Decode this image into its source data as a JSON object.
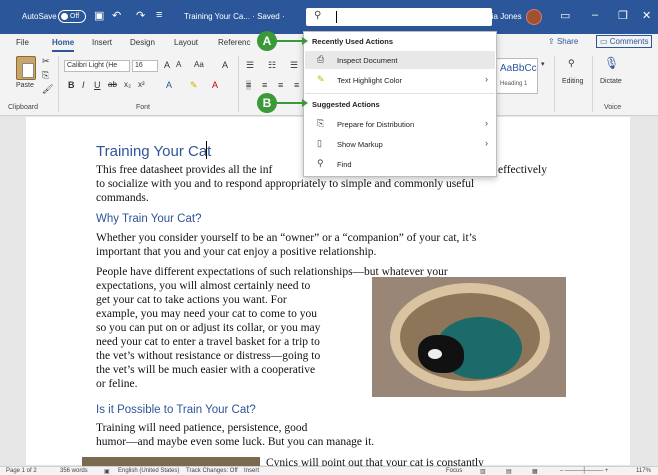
{
  "titlebar": {
    "autosave_label": "AutoSave",
    "autosave_state": "Off",
    "doc_title": "Training Your Ca... · Saved ·",
    "user_name": "Maria Jones",
    "icons": [
      "save-icon",
      "undo-icon",
      "redo-icon",
      "customize-icon",
      "ribbon-display-icon",
      "minimize-icon",
      "restore-icon",
      "close-icon"
    ]
  },
  "ribbon": {
    "tabs": [
      "File",
      "Home",
      "Insert",
      "Design",
      "Layout",
      "Referenc"
    ],
    "active_tab": "Home",
    "share": "Share",
    "comments": "Comments",
    "paste_label": "Paste",
    "font_name": "Calibri Light (He",
    "font_size": "16",
    "group_clipboard": "Clipboard",
    "group_font": "Font",
    "group_voice": "Voice",
    "styles_preview": "AaBbCc",
    "styles_label": "Heading 1",
    "editing_label": "Editing",
    "dictate_label": "Dictate"
  },
  "search_dropdown": {
    "recent_header": "Recently Used Actions",
    "recent_items": [
      {
        "label": "Inspect Document",
        "icon": "inspect-document-icon",
        "highlighted": true
      },
      {
        "label": "Text Highlight Color",
        "icon": "highlighter-icon",
        "chevron": true
      }
    ],
    "suggested_header": "Suggested Actions",
    "suggested_items": [
      {
        "label": "Prepare for Distribution",
        "icon": "prepare-icon",
        "chevron": true
      },
      {
        "label": "Show Markup",
        "icon": "show-markup-icon",
        "chevron": true
      },
      {
        "label": "Find",
        "icon": "search-icon",
        "chevron": false
      }
    ]
  },
  "callouts": {
    "a": "A",
    "b": "B",
    "color": "#3a9a3a"
  },
  "document": {
    "title": "Training Your Cat",
    "intro_lines": [
      "This free datasheet provides all the inf",
      "to socialize with you and to respond appropriately to simple and commonly useful",
      "commands."
    ],
    "intro_tail": "effectively",
    "heading1": "Why Train Your Cat?",
    "para1_lines": [
      "Whether you consider yourself to be an “owner” or a “companion” of your cat, it’s",
      "important that you and your cat enjoy a positive relationship."
    ],
    "para2_lines": [
      "People have different expectations of such relationships—but whatever your",
      "expectations, you will almost certainly need to",
      "get your cat to take actions you want. For",
      "example, you may need your cat to come to you",
      "so you can put on or adjust its collar, or you may",
      "need your cat to enter a travel basket for a trip to",
      "the vet’s without resistance or distress—going to",
      "the vet’s will be much easier with a cooperative",
      "or feline."
    ],
    "heading2": "Is it Possible to Train Your Cat?",
    "para3_lines": [
      "Training will need patience, persistence, good",
      "humor—and maybe even some luck. But you can manage it."
    ],
    "para4_fragment": "Cynics will point out that your cat is constantly"
  },
  "statusbar": {
    "page": "Page 1 of 2",
    "words": "356 words",
    "language": "English (United States)",
    "track_changes": "Track Changes: Off",
    "mode": "Insert",
    "focus": "Focus",
    "zoom": "117%"
  },
  "colors": {
    "titlebar": "#2b579a",
    "heading": "#2f5597",
    "callout": "#3a9a3a"
  }
}
